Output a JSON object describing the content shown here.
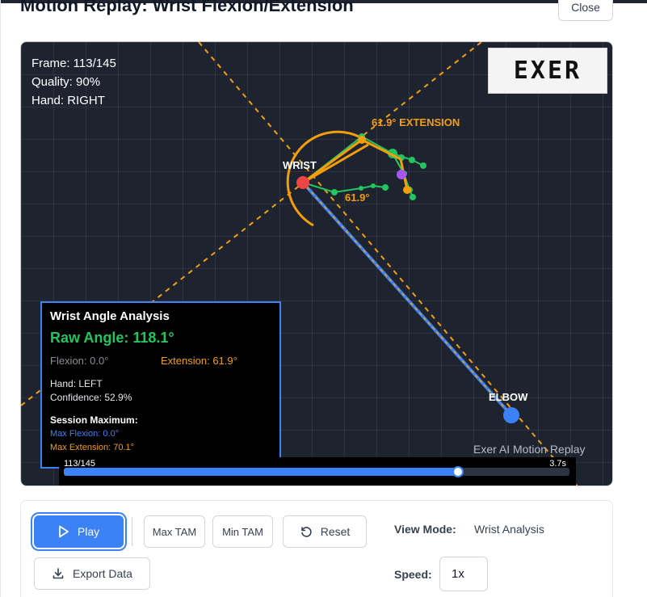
{
  "modal": {
    "title": "Motion Replay: Wrist Flexion/Extension",
    "close_label": "Close"
  },
  "overlay": {
    "frame": "Frame: 113/145",
    "quality": "Quality: 90%",
    "hand": "Hand: RIGHT",
    "logo_text": "EXER"
  },
  "labels": {
    "wrist": "WRIST",
    "elbow": "ELBOW",
    "angle_extension": "61.9° EXTENSION",
    "angle_value": "61.9°"
  },
  "analysis": {
    "title": "Wrist Angle Analysis",
    "raw_angle": "Raw Angle: 118.1°",
    "flexion": "Flexion: 0.0°",
    "extension": "Extension: 61.9°",
    "hand": "Hand: LEFT",
    "confidence": "Confidence: 52.9%",
    "session_title": "Session Maximum:",
    "max_flexion": "Max Flexion: 0.0°",
    "max_extension": "Max Extension: 70.1°"
  },
  "watermark": "Exer AI Motion Replay",
  "timeline": {
    "frame_label": "113/145",
    "time_label": "3.7s",
    "progress": 0.779
  },
  "controls": {
    "play": "Play",
    "max_tam": "Max TAM",
    "min_tam": "Min TAM",
    "reset": "Reset",
    "export": "Export Data",
    "view_mode_label": "View Mode:",
    "view_mode_value": "Wrist Analysis",
    "speed_label": "Speed:",
    "speed_value": "1x"
  },
  "colors": {
    "accent": "#3b82f6",
    "extension": "#f59e0b",
    "raw_angle": "#22c55e",
    "wrist_point": "#ef4444",
    "stage_bg": "#1e2330"
  },
  "icons": {
    "play": "play-icon",
    "reset": "reset-icon",
    "export": "download-icon"
  }
}
